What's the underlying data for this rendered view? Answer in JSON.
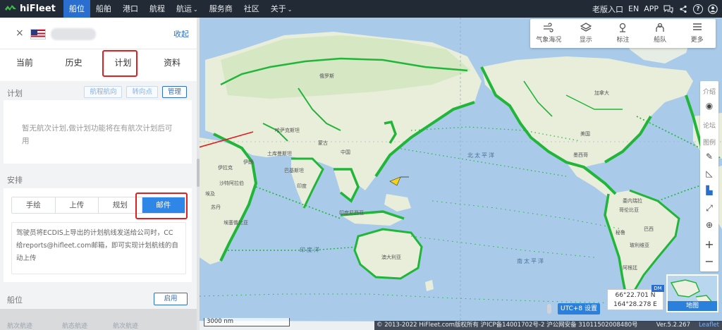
{
  "app": {
    "logo_text": "hiFleet",
    "brand_color": "#2a6fcf"
  },
  "nav": {
    "items": [
      {
        "label": "船位",
        "active": true
      },
      {
        "label": "船舶"
      },
      {
        "label": "港口"
      },
      {
        "label": "航程"
      },
      {
        "label": "航运",
        "has_caret": true
      },
      {
        "label": "服务商"
      },
      {
        "label": "社区"
      },
      {
        "label": "关于",
        "has_caret": true
      }
    ],
    "caret": "⌄",
    "right": {
      "old_version": "老版入口",
      "language": "EN",
      "app": "APP"
    }
  },
  "panel": {
    "collapse_label": "收起",
    "close_icon": "×",
    "tabs": [
      "当前",
      "历史",
      "计划",
      "资料"
    ],
    "active_tab": "计划",
    "plan_section": {
      "title": "计划",
      "buttons": [
        "航程航向",
        "转向点",
        "管理"
      ],
      "empty_text": "暂无航次计划,做计划功能将在有航次计划后可用"
    },
    "arrange_section": {
      "title": "安排",
      "segments": [
        "手绘",
        "上传",
        "规划",
        "邮件"
      ],
      "active_segment": "邮件",
      "mail_note": "驾驶员将ECDIS上导出的计划航线发送给公司时，CC给reports@hifleet.com邮箱，即可实现计划航线的自动上传"
    },
    "berth_section": {
      "title": "船位",
      "enable_label": "启用"
    },
    "bottom_tabs": [
      "航次航迹",
      "航态航迹",
      "航次航迹"
    ]
  },
  "map": {
    "labels": {
      "hajikstan": "哈萨克斯坦",
      "mongolia": "蒙古",
      "china": "中国",
      "iran": "伊朗",
      "iraq": "伊拉克",
      "saudi": "沙特阿拉伯",
      "pakistan": "巴基斯坦",
      "india": "印度",
      "turkmen": "土库曼斯坦",
      "egypt": "埃及",
      "libya": "利比亚",
      "chad": "乍得",
      "ethiopia": "埃塞俄比亚",
      "sudan": "苏丹",
      "drc": "刚果",
      "indonesia": "印度尼西亚",
      "australia": "澳大利亚",
      "russia": "俄罗斯",
      "canada": "加拿大",
      "usa": "美国",
      "mexico": "墨西哥",
      "brazil": "巴西",
      "peru": "秘鲁",
      "bolivia": "玻利维亚",
      "argentina": "阿根廷",
      "greenland": "格陵兰",
      "venez": "委内瑞拉",
      "colombia": "哥伦比亚"
    },
    "oceans": {
      "north_pacific": "北太平洋",
      "indian": "印度洋",
      "south_pacific": "南太平洋"
    },
    "toolbar": [
      "气象海况",
      "显示",
      "标注",
      "船队",
      "更多"
    ],
    "side_items": [
      "介绍",
      "论坛",
      "图例"
    ],
    "coords": {
      "lat": "66°22.701 N",
      "lon": "164°28.278 E"
    },
    "dm_badge": "DM",
    "minimap_label": "地图",
    "utc_label": "UTC+8 设置",
    "scale_label": "3000 nm",
    "attribution": "© 2013-2022 HiFleet.com版权所有 沪ICP备14001702号-2 沪公网安备 31011502008480号",
    "version": "Ver.5.2.267",
    "leaflet": "Leaflet"
  },
  "colors": {
    "ship_dots": "#21b53a",
    "land": "#e9eedb",
    "ocean": "#a9cbe9",
    "highlight_red": "#e02020"
  }
}
